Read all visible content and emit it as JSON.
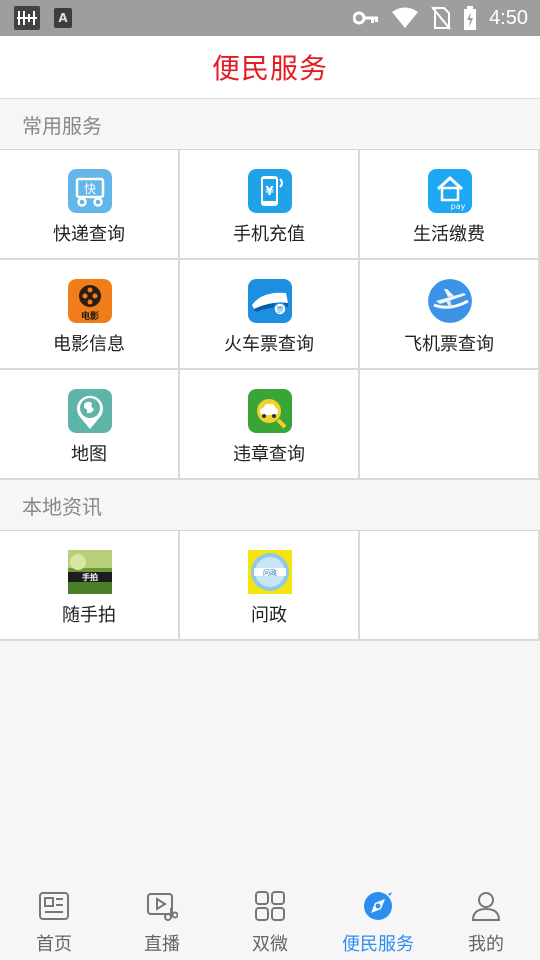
{
  "status_bar": {
    "left_icons": [
      "hearing-icon",
      "font-a-icon"
    ],
    "right_icons": [
      "key-icon",
      "wifi-icon",
      "no-sim-icon",
      "battery-charging-icon"
    ],
    "time": "4:50"
  },
  "header": {
    "title": "便民服务",
    "title_color": "#e51c23"
  },
  "sections": [
    {
      "title": "常用服务",
      "items": [
        {
          "label": "快递查询",
          "icon": "express-delivery-icon"
        },
        {
          "label": "手机充值",
          "icon": "mobile-recharge-icon"
        },
        {
          "label": "生活缴费",
          "icon": "utility-pay-icon"
        },
        {
          "label": "电影信息",
          "icon": "movie-reel-icon"
        },
        {
          "label": "火车票查询",
          "icon": "train-ticket-icon"
        },
        {
          "label": "飞机票查询",
          "icon": "airplane-icon"
        },
        {
          "label": "地图",
          "icon": "map-globe-icon"
        },
        {
          "label": "违章查询",
          "icon": "traffic-violation-icon"
        }
      ]
    },
    {
      "title": "本地资讯",
      "items": [
        {
          "label": "随手拍",
          "icon": "snapshot-photo-icon"
        },
        {
          "label": "问政",
          "icon": "inquiry-politics-icon"
        }
      ]
    }
  ],
  "tab_bar": {
    "active_color": "#2b8ef0",
    "tabs": [
      {
        "label": "首页",
        "icon": "news-icon",
        "active": false
      },
      {
        "label": "直播",
        "icon": "live-video-icon",
        "active": false
      },
      {
        "label": "双微",
        "icon": "grid-icon",
        "active": false
      },
      {
        "label": "便民服务",
        "icon": "compass-icon",
        "active": true
      },
      {
        "label": "我的",
        "icon": "user-icon",
        "active": false
      }
    ]
  }
}
